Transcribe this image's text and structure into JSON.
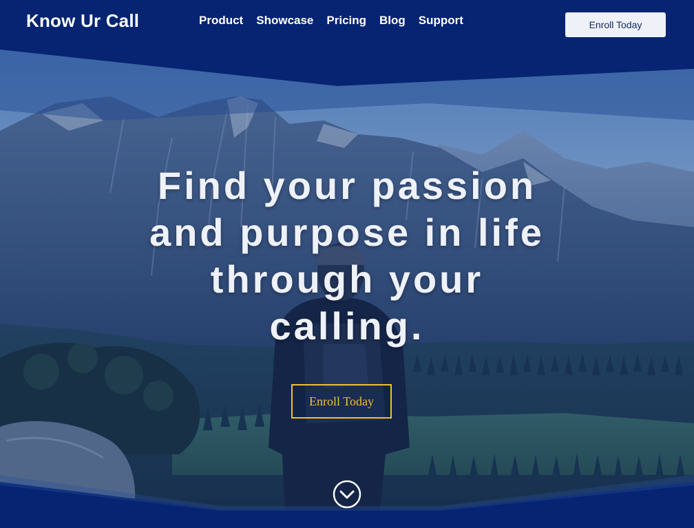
{
  "navbar": {
    "brand": "Know Ur Call",
    "links": [
      "Product",
      "Showcase",
      "Pricing",
      "Blog",
      "Support"
    ],
    "cta_label": "Enroll Today"
  },
  "hero": {
    "headline_lines": [
      "Find your passion",
      "and purpose in life",
      "through your",
      "calling."
    ],
    "cta_label": "Enroll Today",
    "scroll_icon": "chevron-down-circle-icon",
    "background": "mountain-valley-hiker-photo"
  },
  "colors": {
    "nav_bg": "#062471",
    "overlay": "#0b2a6b",
    "cta_gold": "#f2c12e",
    "nav_button_bg": "#eef1f7"
  }
}
